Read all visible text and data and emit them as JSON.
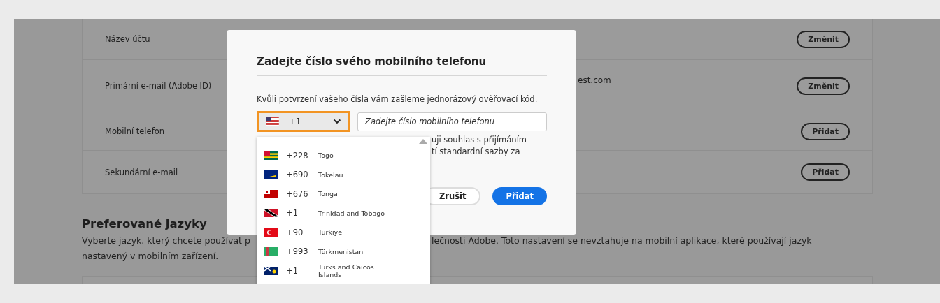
{
  "account_rows": [
    {
      "label": "Název účtu",
      "value_tail": "",
      "button": "Změnit"
    },
    {
      "label": "Primární e-mail (Adobe ID)",
      "value_tail": "est.com",
      "button": "Změnit"
    },
    {
      "label": "Mobilní telefon",
      "value_tail": "",
      "button": "Přidat"
    },
    {
      "label": "Sekundární e-mail",
      "value_tail": "",
      "button": "Přidat"
    }
  ],
  "languages": {
    "heading": "Preferované jazyky",
    "line_1_start": "Vyberte jazyk, který chcete používat p",
    "line_1_end": "lečnosti Adobe. Toto nastavení se nevztahuje na mobilní aplikace, které používají jazyk",
    "line_2": "nastavený v mobilním zařízení."
  },
  "dialog": {
    "title": "Zadejte číslo svého mobilního telefonu",
    "description": "Kvůli potvrzení vašeho čísla vám zašleme jednorázový ověřovací kód.",
    "country_select": {
      "code": "+1",
      "focused": true
    },
    "phone_field": {
      "placeholder": "Zadejte číslo mobilního telefonu"
    },
    "consent_lines": [
      "uji souhlas s přijímáním",
      "tí standardní sazby za"
    ],
    "buttons": [
      {
        "label": "Zrušit",
        "kind": "secondary"
      },
      {
        "label": "Přidat",
        "kind": "primary"
      }
    ]
  },
  "country_list": [
    {
      "code": "+228",
      "name": "Togo",
      "kind": "togo"
    },
    {
      "code": "+690",
      "name": "Tokelau",
      "kind": "tokelau"
    },
    {
      "code": "+676",
      "name": "Tonga",
      "kind": "tonga"
    },
    {
      "code": "+1",
      "name": "Trinidad and Tobago",
      "kind": "trinidad"
    },
    {
      "code": "+90",
      "name": "Türkiye",
      "kind": "turkiye"
    },
    {
      "code": "+993",
      "name": "Türkmenistan",
      "kind": "turkmenistan"
    },
    {
      "code": "+1",
      "name": "Turks and Caicos Islands",
      "kind": "turks"
    }
  ]
}
